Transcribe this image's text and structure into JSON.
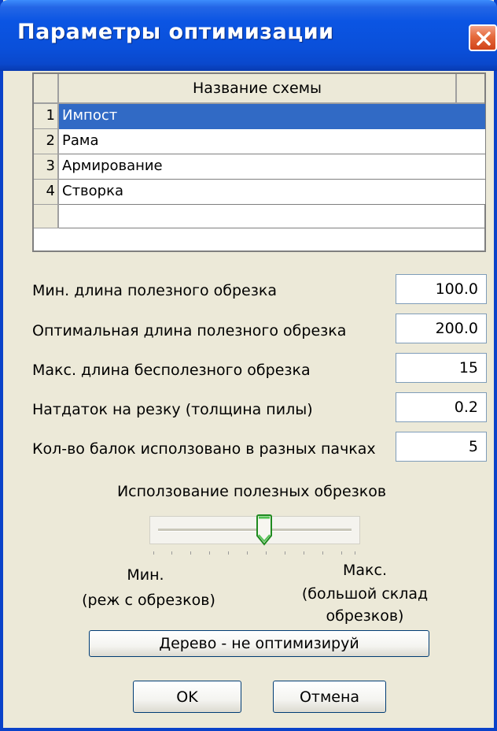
{
  "window": {
    "title": "Параметры оптимизации"
  },
  "grid": {
    "column_header": "Название схемы",
    "rows": [
      {
        "num": "1",
        "name": "Импост",
        "selected": true
      },
      {
        "num": "2",
        "name": "Рама",
        "selected": false
      },
      {
        "num": "3",
        "name": "Армирование",
        "selected": false
      },
      {
        "num": "4",
        "name": "Створка",
        "selected": false
      }
    ]
  },
  "params": {
    "min_useful_label": "Мин. длина полезного обрезка",
    "min_useful_value": "100.0",
    "optimal_useful_label": "Оптимальная длина полезного обрезка",
    "optimal_useful_value": "200.0",
    "max_useless_label": "Макс. длина бесполезного обрезка",
    "max_useless_value": "15",
    "saw_allowance_label": "Натдаток на резку (толщина пилы)",
    "saw_allowance_value": "0.2",
    "beams_label": "Кол-во балок исползовано в разных пачках",
    "beams_value": "5"
  },
  "slider": {
    "title": "Исползование полезных обрезков",
    "min_label_1": "Мин.",
    "min_label_2": "(реж с обрезков)",
    "max_label_1": "Макс.",
    "max_label_2": "(большой склад",
    "max_label_3": "обрезков)",
    "position_fraction": 0.55
  },
  "buttons": {
    "wood_label": "Дерево - не оптимизируй",
    "ok_label": "OK",
    "cancel_label": "Отмена"
  },
  "colors": {
    "titlebar": "#0a4fd9",
    "selection": "#316ac5",
    "close_button": "#e0532a",
    "thumb_accent": "#2f9e2f"
  },
  "icons": {
    "close": "close-x-icon",
    "slider_thumb": "slider-thumb-icon"
  }
}
